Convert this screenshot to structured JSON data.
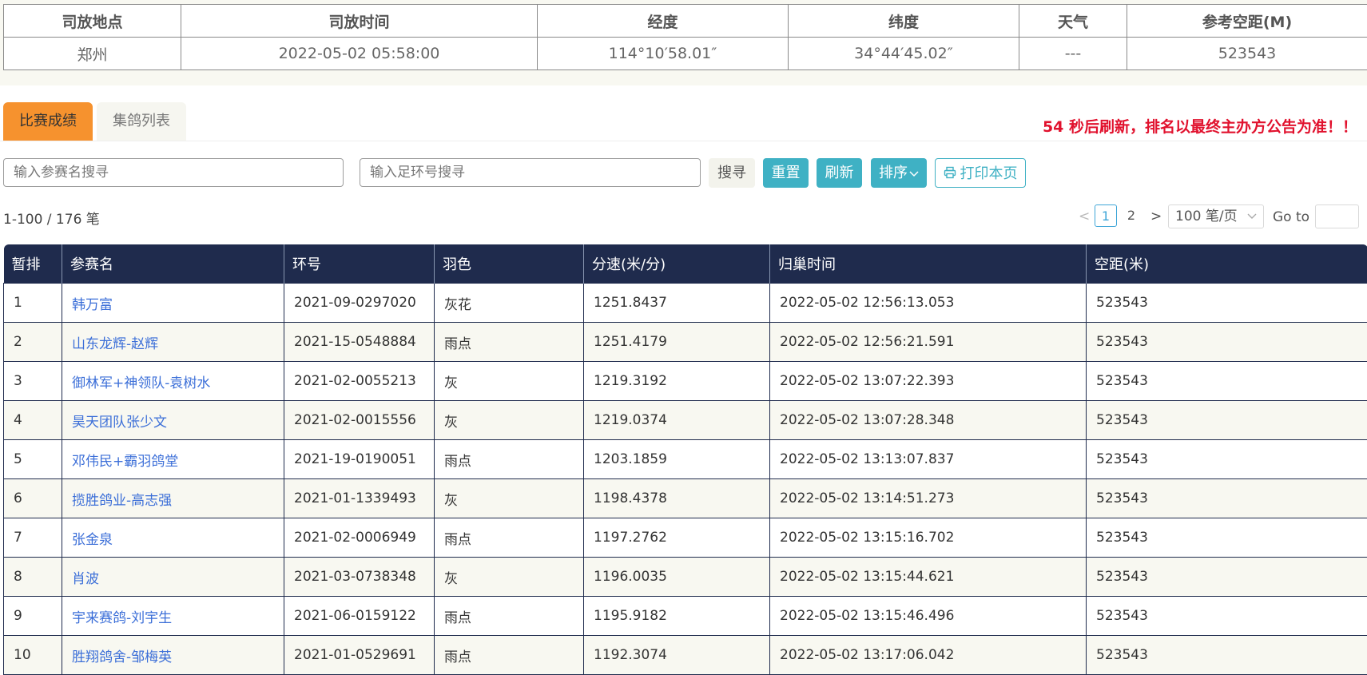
{
  "release": {
    "headers": [
      "司放地点",
      "司放时间",
      "经度",
      "纬度",
      "天气",
      "参考空距(M)"
    ],
    "values": [
      "郑州",
      "2022-05-02 05:58:00",
      "114°10′58.01″",
      "34°44′45.02″",
      "---",
      "523543"
    ]
  },
  "tabs": [
    {
      "label": "比赛成绩",
      "active": true
    },
    {
      "label": "集鸽列表",
      "active": false
    }
  ],
  "notice": "54 秒后刷新，排名以最终主办方公告为准！！",
  "search": {
    "name_placeholder": "输入参赛名搜寻",
    "ring_placeholder": "输入足环号搜寻",
    "search_label": "搜寻",
    "reset_label": "重置",
    "refresh_label": "刷新",
    "sort_label": "排序",
    "print_label": "打印本页"
  },
  "pagination": {
    "range_text": "1-100 / 176 笔",
    "prev": "<",
    "next": ">",
    "pages": [
      "1",
      "2"
    ],
    "current_page": "1",
    "per_page": "100 笔/页",
    "goto_label": "Go to"
  },
  "results": {
    "headers": [
      "暂排",
      "参赛名",
      "环号",
      "羽色",
      "分速(米/分)",
      "归巢时间",
      "空距(米)"
    ],
    "rows": [
      {
        "rank": "1",
        "name": "韩万富",
        "ring": "2021-09-0297020",
        "color": "灰花",
        "speed": "1251.8437",
        "time": "2022-05-02 12:56:13.053",
        "distance": "523543"
      },
      {
        "rank": "2",
        "name": "山东龙辉-赵辉",
        "ring": "2021-15-0548884",
        "color": "雨点",
        "speed": "1251.4179",
        "time": "2022-05-02 12:56:21.591",
        "distance": "523543"
      },
      {
        "rank": "3",
        "name": "御林军+神领队-袁树水",
        "ring": "2021-02-0055213",
        "color": "灰",
        "speed": "1219.3192",
        "time": "2022-05-02 13:07:22.393",
        "distance": "523543"
      },
      {
        "rank": "4",
        "name": "昊天团队张少文",
        "ring": "2021-02-0015556",
        "color": "灰",
        "speed": "1219.0374",
        "time": "2022-05-02 13:07:28.348",
        "distance": "523543"
      },
      {
        "rank": "5",
        "name": "邓伟民+霸羽鸽堂",
        "ring": "2021-19-0190051",
        "color": "雨点",
        "speed": "1203.1859",
        "time": "2022-05-02 13:13:07.837",
        "distance": "523543"
      },
      {
        "rank": "6",
        "name": "揽胜鸽业-高志强",
        "ring": "2021-01-1339493",
        "color": "灰",
        "speed": "1198.4378",
        "time": "2022-05-02 13:14:51.273",
        "distance": "523543"
      },
      {
        "rank": "7",
        "name": "张金泉",
        "ring": "2021-02-0006949",
        "color": "雨点",
        "speed": "1197.2762",
        "time": "2022-05-02 13:15:16.702",
        "distance": "523543"
      },
      {
        "rank": "8",
        "name": "肖波",
        "ring": "2021-03-0738348",
        "color": "灰",
        "speed": "1196.0035",
        "time": "2022-05-02 13:15:44.621",
        "distance": "523543"
      },
      {
        "rank": "9",
        "name": "宇来赛鸽-刘宇生",
        "ring": "2021-06-0159122",
        "color": "雨点",
        "speed": "1195.9182",
        "time": "2022-05-02 13:15:46.496",
        "distance": "523543"
      },
      {
        "rank": "10",
        "name": "胜翔鸽舍-邹梅英",
        "ring": "2021-01-0529691",
        "color": "雨点",
        "speed": "1192.3074",
        "time": "2022-05-02 13:17:06.042",
        "distance": "523543"
      }
    ]
  },
  "colors": {
    "tab_active": "#f6922e",
    "teal_button": "#3fb1c4",
    "table_header": "#1f2b4d",
    "notice_red": "#e1112d",
    "link_blue": "#3c6fd8"
  },
  "icons": {
    "sort": "chevron-down-icon",
    "print": "printer-icon"
  }
}
